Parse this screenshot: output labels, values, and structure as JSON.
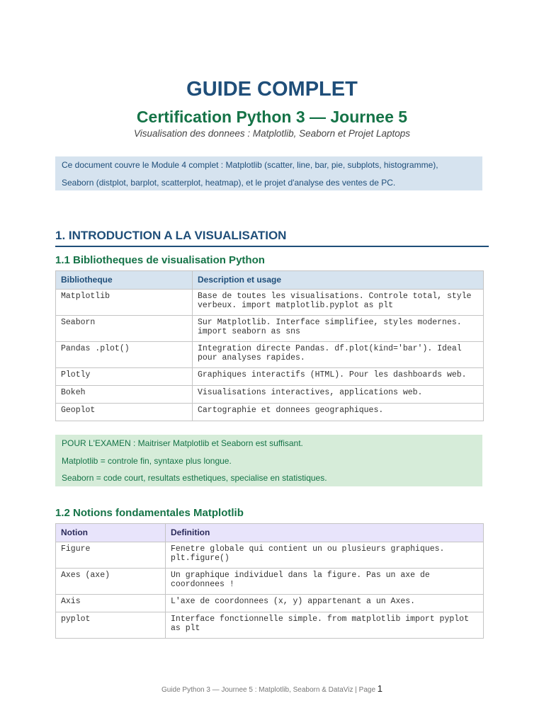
{
  "header": {
    "title": "GUIDE COMPLET",
    "subtitle": "Certification Python 3 — Journee 5",
    "tagline": "Visualisation des donnees : Matplotlib, Seaborn et Projet Laptops"
  },
  "intro_box": {
    "line1": "Ce document couvre le Module 4 complet : Matplotlib (scatter, line, bar, pie, subplots, histogramme),",
    "line2": "Seaborn (distplot, barplot, scatterplot, heatmap), et le projet d'analyse des ventes de PC."
  },
  "section1": {
    "heading": "1.  INTRODUCTION A LA VISUALISATION",
    "sub1": {
      "heading": "1.1  Bibliotheques de visualisation Python",
      "table": {
        "headers": [
          "Bibliotheque",
          "Description et usage"
        ],
        "rows": [
          {
            "name": "Matplotlib",
            "desc1": "Base de toutes les visualisations. Controle total, style",
            "desc2": "verbeux. import matplotlib.pyplot as plt"
          },
          {
            "name": "Seaborn",
            "desc1": "Sur Matplotlib. Interface simplifiee, styles modernes.",
            "desc2": "import seaborn as sns"
          },
          {
            "name": "Pandas .plot()",
            "desc1": "Integration directe Pandas. df.plot(kind='bar'). Ideal",
            "desc2": "pour analyses rapides."
          },
          {
            "name": "Plotly",
            "desc1": "Graphiques interactifs (HTML). Pour les dashboards web."
          },
          {
            "name": "Bokeh",
            "desc1": "Visualisations interactives, applications web."
          },
          {
            "name": "Geoplot",
            "desc1": "Cartographie et donnees geographiques."
          }
        ]
      }
    },
    "exam_box": {
      "line1": "POUR L'EXAMEN : Maitriser Matplotlib et Seaborn est suffisant.",
      "line2": "Matplotlib = controle fin, syntaxe plus longue.",
      "line3": "Seaborn = code court, resultats esthetiques, specialise en statistiques."
    },
    "sub2": {
      "heading": "1.2  Notions fondamentales Matplotlib",
      "table": {
        "headers": [
          "Notion",
          "Definition"
        ],
        "rows": [
          {
            "name": "Figure",
            "desc1": "Fenetre globale qui contient un ou plusieurs graphiques.",
            "desc2": "plt.figure()"
          },
          {
            "name": "Axes (axe)",
            "desc1": "Un graphique individuel dans la figure. Pas un axe de",
            "desc2": "coordonnees !"
          },
          {
            "name": "Axis",
            "desc1": "L'axe de coordonnees (x, y) appartenant a un Axes."
          },
          {
            "name": "pyplot",
            "desc1": "Interface fonctionnelle simple. from matplotlib import pyplot",
            "desc2": "as plt"
          }
        ]
      }
    }
  },
  "footer": {
    "text": "Guide Python 3 — Journee 5 : Matplotlib, Seaborn & DataViz  |  Page ",
    "page": "1"
  }
}
